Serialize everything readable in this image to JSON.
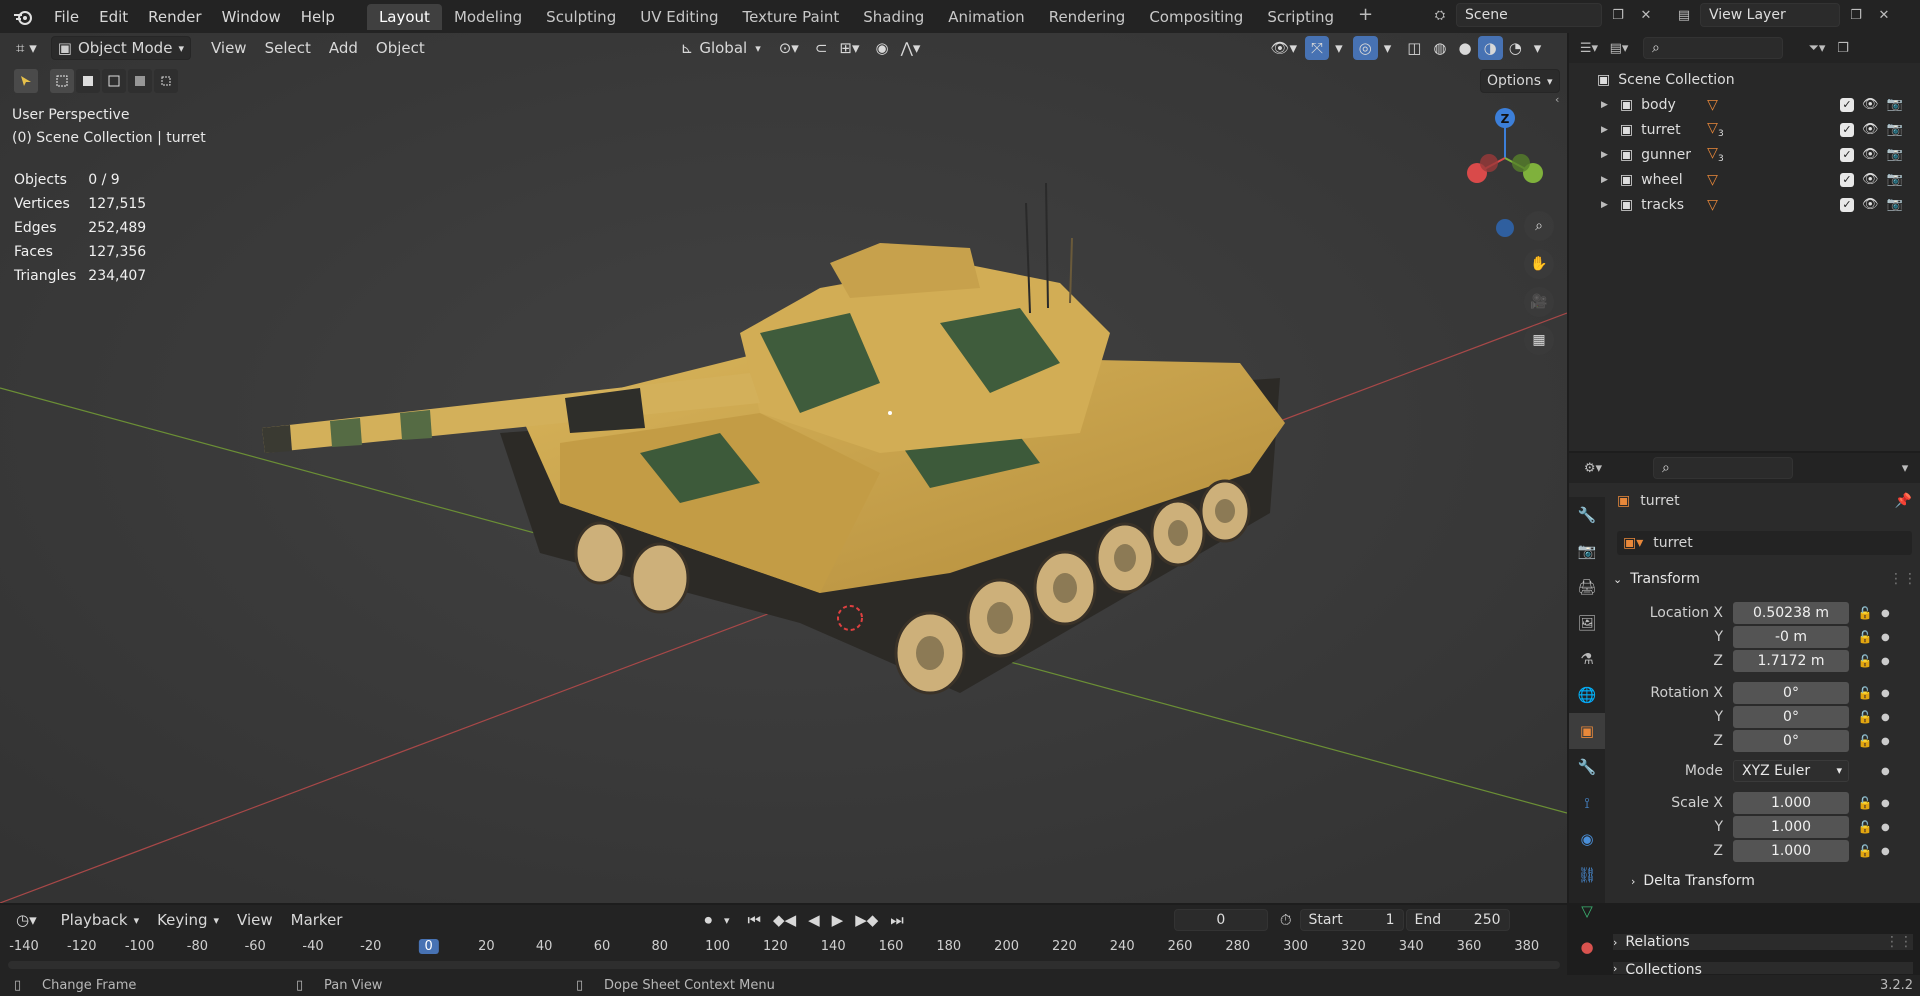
{
  "menu": {
    "file": "File",
    "edit": "Edit",
    "render": "Render",
    "window": "Window",
    "help": "Help"
  },
  "workspaces": [
    "Layout",
    "Modeling",
    "Sculpting",
    "UV Editing",
    "Texture Paint",
    "Shading",
    "Animation",
    "Rendering",
    "Compositing",
    "Scripting"
  ],
  "scene_name": "Scene",
  "view_layer_name": "View Layer",
  "viewport": {
    "mode": "Object Mode",
    "menus": [
      "View",
      "Select",
      "Add",
      "Object"
    ],
    "orientation": "Global",
    "options_label": "Options",
    "perspective": "User Perspective",
    "collection_info": "(0) Scene Collection | turret",
    "stats": [
      {
        "label": "Objects",
        "value": "0 / 9"
      },
      {
        "label": "Vertices",
        "value": "127,515"
      },
      {
        "label": "Edges",
        "value": "252,489"
      },
      {
        "label": "Faces",
        "value": "127,356"
      },
      {
        "label": "Triangles",
        "value": "234,407"
      }
    ],
    "gizmo": {
      "z": "Z"
    }
  },
  "outliner": {
    "root": "Scene Collection",
    "items": [
      {
        "name": "body",
        "badge": ""
      },
      {
        "name": "turret",
        "badge": "3"
      },
      {
        "name": "gunner",
        "badge": "3"
      },
      {
        "name": "wheel",
        "badge": ""
      },
      {
        "name": "tracks",
        "badge": ""
      }
    ]
  },
  "properties": {
    "object_name": "turret",
    "data_name": "turret",
    "transform_label": "Transform",
    "location_label": "Location X",
    "location": [
      "0.50238 m",
      "-0 m",
      "1.7172 m"
    ],
    "rotation_label": "Rotation X",
    "rotation": [
      "0°",
      "0°",
      "0°"
    ],
    "mode_label": "Mode",
    "mode_value": "XYZ Euler",
    "scale_label": "Scale X",
    "scale": [
      "1.000",
      "1.000",
      "1.000"
    ],
    "y_label": "Y",
    "z_label": "Z",
    "delta_label": "Delta Transform",
    "relations_label": "Relations",
    "collections_label": "Collections"
  },
  "timeline": {
    "menus": [
      "Playback",
      "Keying",
      "View",
      "Marker"
    ],
    "current_frame": "0",
    "start_label": "Start",
    "start": "1",
    "end_label": "End",
    "end": "250",
    "ticks": [
      "-140",
      "-120",
      "-100",
      "-80",
      "-60",
      "-40",
      "-20",
      "0",
      "20",
      "40",
      "60",
      "80",
      "100",
      "120",
      "140",
      "160",
      "180",
      "200",
      "220",
      "240",
      "260",
      "280",
      "300",
      "320",
      "340",
      "360",
      "380"
    ]
  },
  "status": {
    "change_frame": "Change Frame",
    "pan_view": "Pan View",
    "dope_sheet": "Dope Sheet Context Menu",
    "version": "3.2.2"
  },
  "colors": {
    "accent": "#4772b3",
    "object_orange": "#e8883a",
    "x_axis": "#d94a4a",
    "y_axis": "#7fb13c",
    "z_axis": "#3c7fd9"
  }
}
